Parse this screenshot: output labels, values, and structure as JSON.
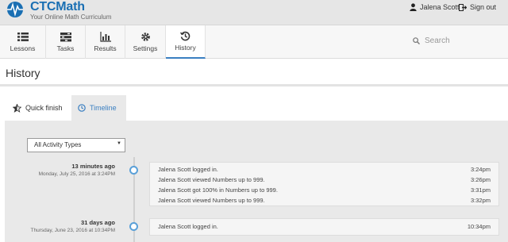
{
  "brand": {
    "name": "CTCMath",
    "tagline": "Your Online Math Curriculum"
  },
  "user": {
    "name": "Jalena Scott",
    "signout_label": "Sign out"
  },
  "nav": {
    "items": [
      {
        "label": "Lessons",
        "icon": "list-icon"
      },
      {
        "label": "Tasks",
        "icon": "tasks-icon"
      },
      {
        "label": "Results",
        "icon": "bar-chart-icon"
      },
      {
        "label": "Settings",
        "icon": "gear-icon"
      },
      {
        "label": "History",
        "icon": "history-icon"
      }
    ],
    "active": "History"
  },
  "search": {
    "placeholder": "Search"
  },
  "page": {
    "title": "History"
  },
  "tabs": [
    {
      "label": "Quick finish",
      "icon": "star-icon"
    },
    {
      "label": "Timeline",
      "icon": "clock-icon"
    }
  ],
  "filter": {
    "selected": "All Activity Types"
  },
  "timeline": [
    {
      "ago": "13 minutes ago",
      "date": "Monday, July 25, 2016 at 3:24PM",
      "events": [
        {
          "text": "Jalena Scott logged in.",
          "time": "3:24pm"
        },
        {
          "text": "Jalena Scott viewed Numbers up to 999.",
          "time": "3:26pm"
        },
        {
          "text": "Jalena Scott got 100% in Numbers up to 999.",
          "time": "3:31pm"
        },
        {
          "text": "Jalena Scott viewed Numbers up to 999.",
          "time": "3:32pm"
        }
      ]
    },
    {
      "ago": "31 days ago",
      "date": "Thursday, June 23, 2016 at 10:34PM",
      "events": [
        {
          "text": "Jalena Scott logged in.",
          "time": "10:34pm"
        }
      ]
    }
  ],
  "colors": {
    "accent": "#3a7fc1",
    "brand": "#1a6fb3",
    "timeline_dot": "#5aa0d8",
    "panel_bg": "#e9e9e9"
  }
}
